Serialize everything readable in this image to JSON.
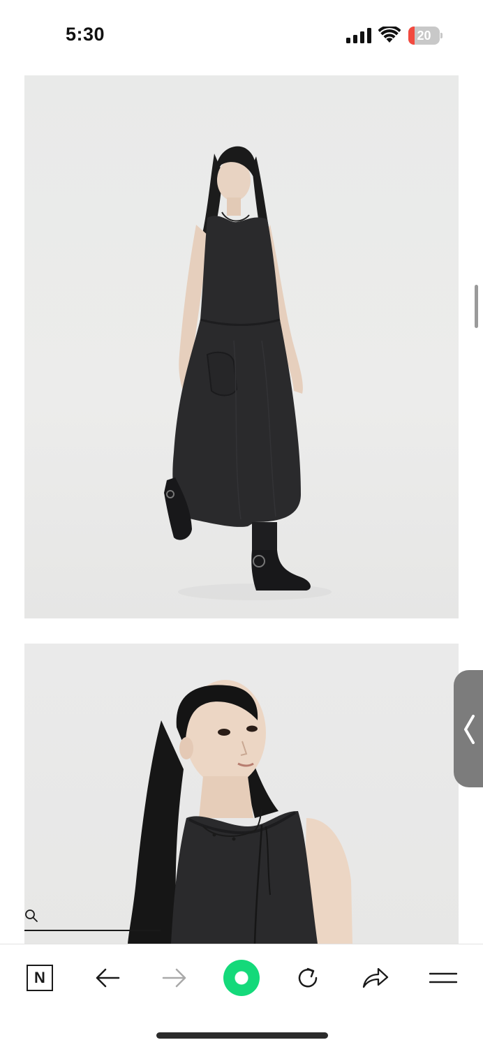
{
  "status_bar": {
    "time": "5:30",
    "battery_level": "20",
    "battery_fraction": 0.2,
    "icons": [
      "cellular-signal-icon",
      "wifi-icon",
      "battery-icon"
    ]
  },
  "content": {
    "photos": [
      {
        "id": "photo-1",
        "subject": "model-full-body"
      },
      {
        "id": "photo-2",
        "subject": "model-portrait"
      }
    ]
  },
  "search": {
    "icon": "search-icon"
  },
  "toolbar": {
    "buttons": [
      {
        "name": "naver-home-button",
        "label": "N",
        "icon": "naver-n-icon"
      },
      {
        "name": "back-button",
        "icon": "arrow-left-icon"
      },
      {
        "name": "forward-button",
        "icon": "arrow-right-icon",
        "disabled": true
      },
      {
        "name": "green-dot-button",
        "icon": "green-dot-icon"
      },
      {
        "name": "reload-button",
        "icon": "reload-icon"
      },
      {
        "name": "share-button",
        "icon": "share-arrow-icon"
      },
      {
        "name": "menu-button",
        "icon": "menu-icon"
      }
    ]
  },
  "colors": {
    "accent_green": "#14d97a",
    "battery_low": "#f24a3f",
    "side_handle": "#7c7c7c",
    "dress": "#2a2a2c"
  }
}
